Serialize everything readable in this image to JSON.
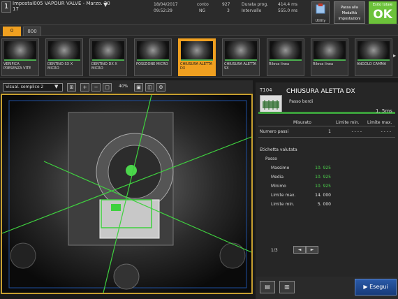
{
  "program": {
    "number": "1",
    "title": "Impostal005  VAPOUR  VALVE  -  Marzo.  20  17"
  },
  "status": {
    "date": "18/04/2017",
    "time": "09:52:29",
    "count_label": "conto",
    "count_value": "927",
    "ng_label": "NG",
    "ng_value": "3",
    "prog_label": "Durata prog.",
    "prog_value": "414.4  ms",
    "interval_label": "Intervallo",
    "interval_value": "555.0  ms"
  },
  "buttons": {
    "utility": "Utility",
    "mode": "Passa alla Modalità Impostazioni",
    "result_label": "Esito totale",
    "result_value": "OK"
  },
  "tabs": [
    {
      "label": "0"
    },
    {
      "label": "800"
    }
  ],
  "thumbnails": [
    {
      "label": "VERIFICA PRESENZA VITE",
      "active": false
    },
    {
      "label": "DENTINO SX X MICRO",
      "active": false
    },
    {
      "label": "DENTINO DX X MICRO",
      "active": false
    },
    {
      "label": "POSIZIONE MICRO",
      "active": false
    },
    {
      "label": "CHIUSURA ALETTA DX",
      "active": true
    },
    {
      "label": "CHIUSURA ALETTA SX",
      "active": false
    },
    {
      "label": "Rileva linea",
      "active": false
    },
    {
      "label": "Rileva linea",
      "active": false
    },
    {
      "label": "ANGOLO CAMMA",
      "active": false
    }
  ],
  "toolbar": {
    "view_mode": "Visual.  semplice  2",
    "zoom": "40%"
  },
  "tool": {
    "code": "T104",
    "title": "CHIUSURA  ALETTA  DX",
    "description": "Passo bordi",
    "time": "1. 5ms"
  },
  "table": {
    "headers": [
      "Misurato",
      "Limite min.",
      "Limite max."
    ],
    "num_steps_label": "Numero passi",
    "num_steps_values": [
      "1",
      "- - - -",
      "- - - -"
    ],
    "eval_label": "Etichetta valutata",
    "step_label": "Passo",
    "rows": [
      {
        "label": "Massimo",
        "value": "10. 925"
      },
      {
        "label": "Media",
        "value": "10. 925"
      },
      {
        "label": "Minimo",
        "value": "10. 925"
      },
      {
        "label": "Limite max.",
        "value": "14. 000"
      },
      {
        "label": "Limite min.",
        "value": "5. 000"
      }
    ]
  },
  "pager": {
    "info": "1/3"
  },
  "run": {
    "label": "Esegui"
  },
  "colors": {
    "accent": "#f0a020",
    "ok_green": "#6cc23a",
    "value_green": "#4cd64c",
    "run_blue": "#2a5aa8"
  }
}
